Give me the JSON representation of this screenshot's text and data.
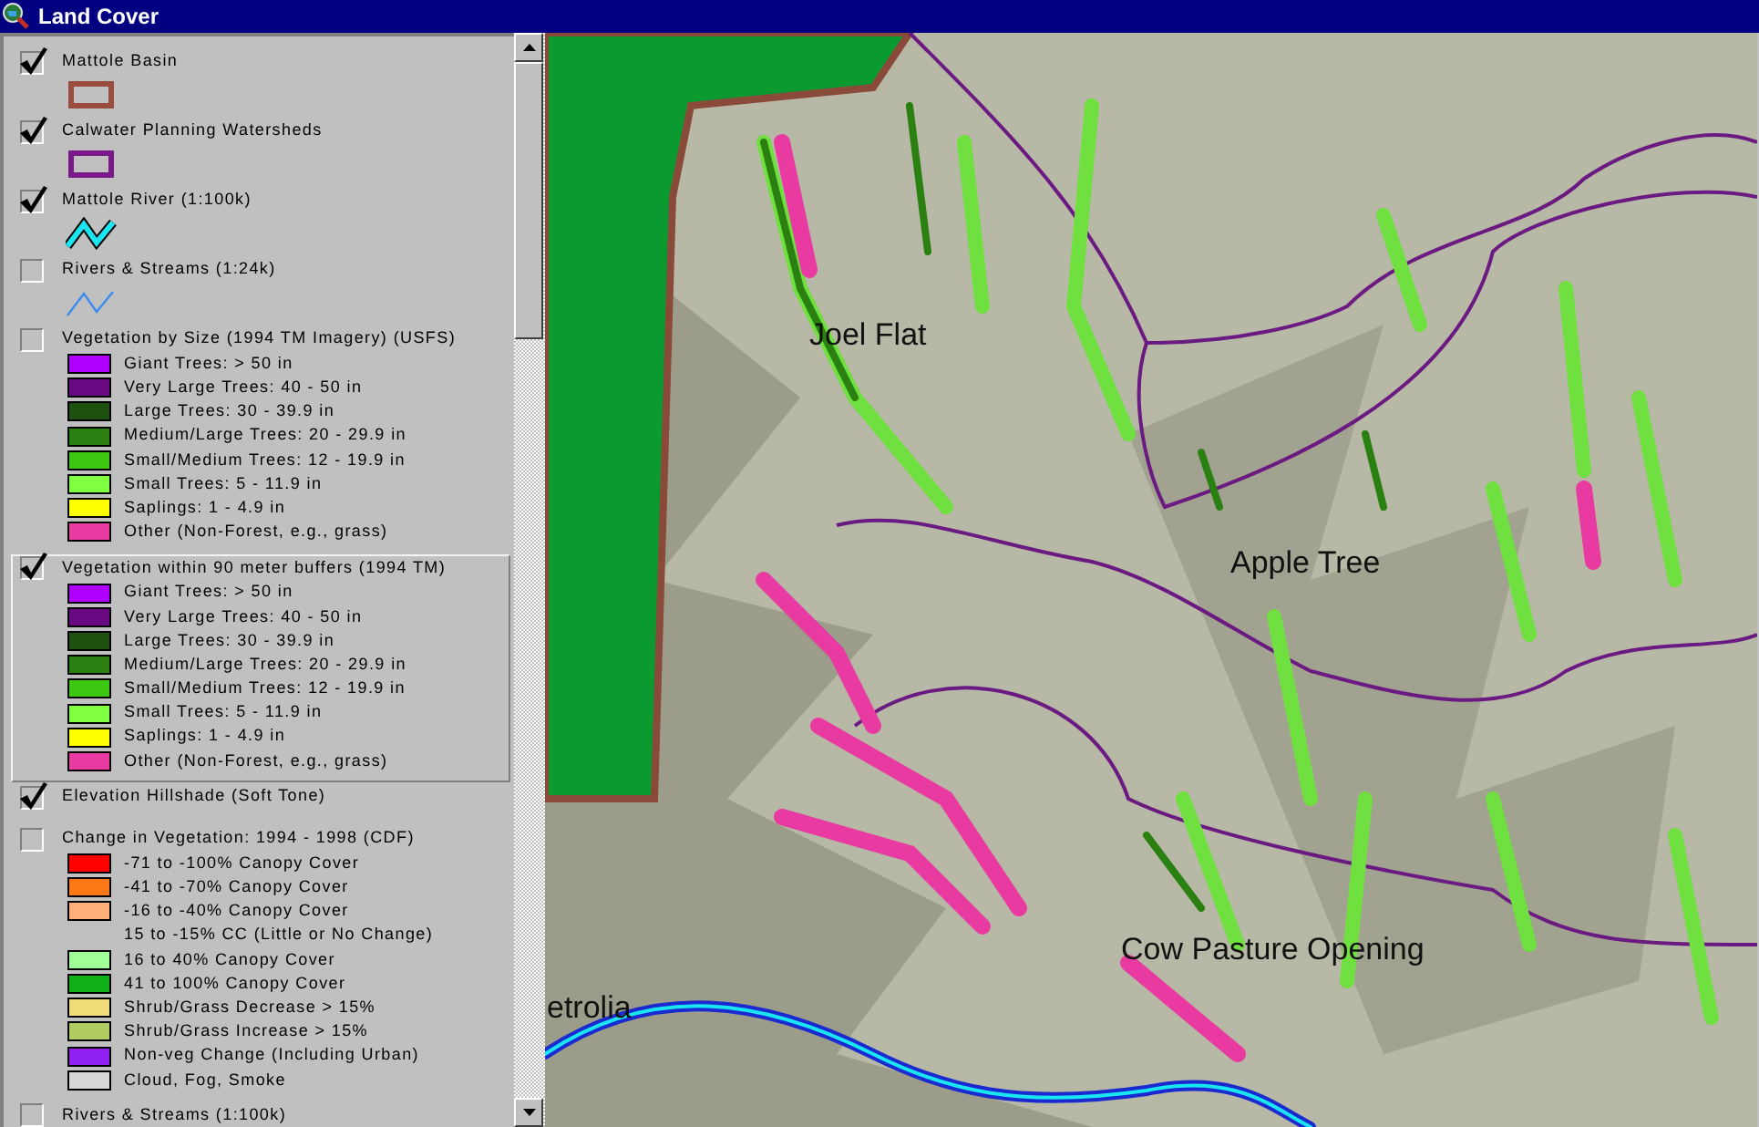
{
  "window": {
    "title": "Land Cover"
  },
  "layers": [
    {
      "name": "Mattole Basin",
      "checked": true,
      "selected": false,
      "symbol": {
        "kind": "polygon",
        "color": "#9a4c3e"
      }
    },
    {
      "name": "Calwater Planning Watersheds",
      "checked": true,
      "selected": false,
      "symbol": {
        "kind": "polygon",
        "color": "#7a1a8a"
      }
    },
    {
      "name": "Mattole River (1:100k)",
      "checked": true,
      "selected": false,
      "symbol": {
        "kind": "river",
        "color": "#19e6f0"
      }
    },
    {
      "name": "Rivers & Streams (1:24k)",
      "checked": false,
      "selected": false,
      "symbol": {
        "kind": "line",
        "color": "#3a8cf0"
      }
    },
    {
      "name": "Vegetation by Size (1994 TM Imagery) (USFS)",
      "checked": false,
      "selected": false,
      "classes": [
        {
          "label": "Giant Trees: > 50 in",
          "color": "#b000ff"
        },
        {
          "label": "Very Large Trees: 40 - 50 in",
          "color": "#6a0a82"
        },
        {
          "label": "Large Trees: 30 - 39.9 in",
          "color": "#1e5010"
        },
        {
          "label": "Medium/Large Trees: 20 - 29.9 in",
          "color": "#2a8010"
        },
        {
          "label": "Small/Medium Trees: 12 - 19.9 in",
          "color": "#3cc810"
        },
        {
          "label": "Small Trees: 5 - 11.9 in",
          "color": "#80ff40"
        },
        {
          "label": "Saplings: 1 - 4.9 in",
          "color": "#ffff00"
        },
        {
          "label": "Other (Non-Forest, e.g., grass)",
          "color": "#e83aa0"
        }
      ]
    },
    {
      "name": "Vegetation within 90 meter buffers (1994 TM)",
      "checked": true,
      "selected": true,
      "classes": [
        {
          "label": "Giant Trees: > 50 in",
          "color": "#b000ff"
        },
        {
          "label": "Very Large Trees: 40 - 50 in",
          "color": "#6a0a82"
        },
        {
          "label": "Large Trees: 30 - 39.9 in",
          "color": "#1e5010"
        },
        {
          "label": "Medium/Large Trees: 20 - 29.9 in",
          "color": "#2a8010"
        },
        {
          "label": "Small/Medium Trees: 12 - 19.9 in",
          "color": "#3cc810"
        },
        {
          "label": "Small Trees: 5 - 11.9 in",
          "color": "#80ff40"
        },
        {
          "label": "Saplings: 1 - 4.9 in",
          "color": "#ffff00"
        },
        {
          "label": "Other (Non-Forest, e.g., grass)",
          "color": "#e83aa0"
        }
      ]
    },
    {
      "name": "Elevation Hillshade (Soft Tone)",
      "checked": true,
      "selected": false
    },
    {
      "name": "Change in Vegetation: 1994 - 1998 (CDF)",
      "checked": false,
      "selected": false,
      "classes": [
        {
          "label": "-71 to -100% Canopy Cover",
          "color": "#ff0000"
        },
        {
          "label": "-41 to -70% Canopy Cover",
          "color": "#ff7818"
        },
        {
          "label": "-16 to -40% Canopy Cover",
          "color": "#ffb078"
        },
        {
          "label": "15 to -15% CC (Little or No Change)"
        },
        {
          "label": "16 to 40% Canopy Cover",
          "color": "#a0ff98"
        },
        {
          "label": "41 to 100% Canopy Cover",
          "color": "#10b018"
        },
        {
          "label": "Shrub/Grass Decrease > 15%",
          "color": "#f0dc78"
        },
        {
          "label": "Shrub/Grass Increase > 15%",
          "color": "#b0cc60"
        },
        {
          "label": "Non-veg Change (Including Urban)",
          "color": "#9020f0"
        },
        {
          "label": "Cloud, Fog, Smoke",
          "color": "#d8d8d8"
        }
      ]
    },
    {
      "name": "Rivers & Streams (1:100k)",
      "checked": false,
      "selected": false
    }
  ],
  "map": {
    "labels": [
      "Joel Flat",
      "Apple Tree",
      "Cow Pasture Opening",
      "etrolia"
    ]
  }
}
